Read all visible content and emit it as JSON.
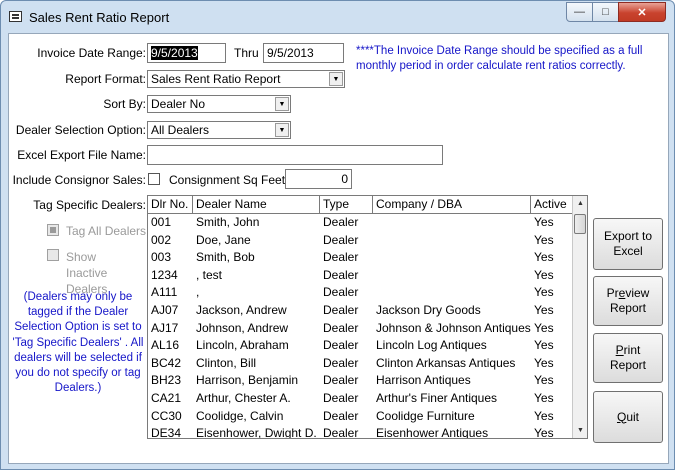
{
  "window": {
    "title": "Sales Rent Ratio Report",
    "minimize": "—",
    "maximize": "□",
    "close": "✕"
  },
  "form": {
    "invoice_label": "Invoice Date Range:",
    "date_from": "9/5/2013",
    "thru_label": "Thru",
    "date_to": "9/5/2013",
    "date_note": "****The Invoice Date Range should be specified as a full monthly period in order calculate rent ratios correctly.",
    "format_label": "Report Format:",
    "format_value": "Sales Rent Ratio Report",
    "sort_label": "Sort By:",
    "sort_value": "Dealer No",
    "dealer_sel_label": "Dealer Selection Option:",
    "dealer_sel_value": "All Dealers",
    "excel_label": "Excel Export File Name:",
    "excel_value": "",
    "consignor_label": "Include Consignor Sales:",
    "consign_sqft_label": "Consignment Sq Feet:",
    "consign_sqft_value": "0",
    "tag_label": "Tag Specific Dealers:",
    "tag_all_label": "Tag All Dealers",
    "show_inactive_label": "Show Inactive Dealers",
    "tag_note": "(Dealers may only be tagged if the Dealer Selection Option is set to 'Tag Specific Dealers' . All dealers will be selected if you do not specify or tag Dealers.)"
  },
  "grid": {
    "columns": [
      "Dlr No.",
      "Dealer Name",
      "Type",
      "Company / DBA",
      "Active"
    ],
    "rows": [
      [
        "001",
        "Smith, John",
        "Dealer",
        "",
        "Yes"
      ],
      [
        "002",
        "Doe, Jane",
        "Dealer",
        "",
        "Yes"
      ],
      [
        "003",
        "Smith, Bob",
        "Dealer",
        "",
        "Yes"
      ],
      [
        "1234",
        ", test",
        "Dealer",
        "",
        "Yes"
      ],
      [
        "A111",
        ",",
        "Dealer",
        "",
        "Yes"
      ],
      [
        "AJ07",
        "Jackson, Andrew",
        "Dealer",
        "Jackson Dry Goods",
        "Yes"
      ],
      [
        "AJ17",
        "Johnson, Andrew",
        "Dealer",
        "Johnson & Johnson Antiques",
        "Yes"
      ],
      [
        "AL16",
        "Lincoln, Abraham",
        "Dealer",
        "Lincoln Log Antiques",
        "Yes"
      ],
      [
        "BC42",
        "Clinton, Bill",
        "Dealer",
        "Clinton Arkansas Antiques",
        "Yes"
      ],
      [
        "BH23",
        "Harrison, Benjamin",
        "Dealer",
        "Harrison Antiques",
        "Yes"
      ],
      [
        "CA21",
        "Arthur, Chester A.",
        "Dealer",
        "Arthur's Finer Antiques",
        "Yes"
      ],
      [
        "CC30",
        "Coolidge, Calvin",
        "Dealer",
        "Coolidge Furniture",
        "Yes"
      ],
      [
        "DE34",
        "Eisenhower, Dwight D.",
        "Dealer",
        "Eisenhower Antiques",
        "Yes"
      ]
    ]
  },
  "buttons": {
    "export_line1": "Export to",
    "export_line2": "Excel",
    "preview_line1": "Preview",
    "preview_line2": "Report",
    "print_line1": "Print",
    "print_line2": "Report",
    "quit": "Quit"
  }
}
